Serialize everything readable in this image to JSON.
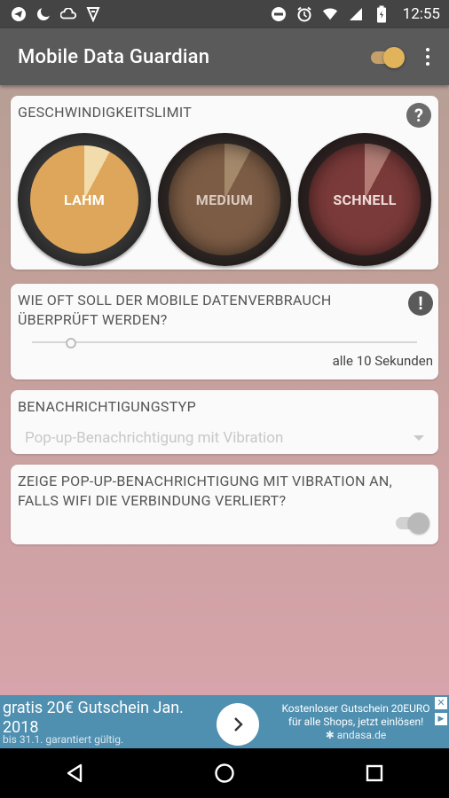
{
  "status_bar": {
    "time": "12:55",
    "left_icons": [
      "telegram-icon",
      "moon-icon",
      "cloud-icon",
      "vpn-icon"
    ],
    "right_icons": [
      "dnd-icon",
      "alarm-icon",
      "wifi-icon",
      "signal-icon",
      "battery-icon"
    ]
  },
  "app_bar": {
    "title": "Mobile Data Guardian",
    "master_toggle": "on"
  },
  "speed_card": {
    "title": "GESCHWINDIGKEITSLIMIT",
    "help_glyph": "?",
    "dials": [
      {
        "label": "LAHM",
        "selected": true,
        "color": "#dea65a"
      },
      {
        "label": "MEDIUM",
        "selected": false,
        "color": "#7c5c45"
      },
      {
        "label": "SCHNELL",
        "selected": false,
        "color": "#7a3a39"
      }
    ]
  },
  "interval_card": {
    "title": "WIE OFT SOLL DER MOBILE DATENVERBRAUCH ÜBERPRÜFT WERDEN?",
    "warn_glyph": "!",
    "slider_value": 0.09,
    "value_text": "alle 10 Sekunden"
  },
  "notification_card": {
    "title": "BENACHRICHTIGUNGSTYP",
    "selected_option": "Pop-up-Benachrichtigung mit Vibration"
  },
  "wifi_card": {
    "title": "ZEIGE POP-UP-BENACHRICHTIGUNG MIT VIBRATION AN, FALLS WIFI DIE VERBINDUNG VERLIERT?",
    "toggle": "off"
  },
  "ad": {
    "headline": "gratis 20€ Gutschein Jan. 2018",
    "sub": "bis 31.1. garantiert gültig.",
    "right_line1": "Kostenloser Gutschein 20EURO",
    "right_line2": "für alle Shops, jetzt einlösen!",
    "domain": "andasa.de"
  },
  "colors": {
    "app_bar": "#5a5a5a",
    "accent": "#e1b45b",
    "ad_bg": "#4f8fb0"
  }
}
